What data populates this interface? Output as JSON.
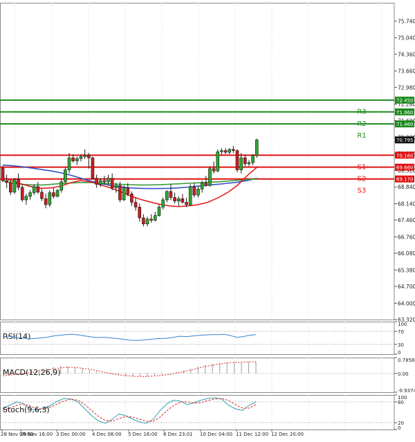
{
  "chart_data": {
    "type": "candlestick",
    "price_axis": {
      "min": 63.32,
      "max": 76.5,
      "ticks": [
        "75.740",
        "75.040",
        "74.360",
        "73.660",
        "72.980",
        "72.280",
        "71.600",
        "70.900",
        "70.220",
        "69.520",
        "68.840",
        "68.140",
        "67.460",
        "66.760",
        "66.080",
        "65.380",
        "64.700",
        "64.000",
        "63.320"
      ]
    },
    "levels": [
      {
        "name": "R3",
        "value": 72.45,
        "label": "72.450",
        "color": "#1a8a1a"
      },
      {
        "name": "R2",
        "value": 71.96,
        "label": "71.960",
        "color": "#1a8a1a"
      },
      {
        "name": "R1",
        "value": 71.46,
        "label": "71.460",
        "color": "#1a8a1a"
      },
      {
        "name": "S1",
        "value": 70.16,
        "label": "70.160",
        "color": "#e01010"
      },
      {
        "name": "S2",
        "value": 69.66,
        "label": "69.660",
        "color": "#e01010"
      },
      {
        "name": "S3",
        "value": 69.17,
        "label": "69.170",
        "color": "#e01010"
      }
    ],
    "current_price": {
      "value": 70.795,
      "label": "70.795"
    },
    "candles": [
      [
        69.62,
        69.72,
        69.05,
        69.1
      ],
      [
        69.1,
        69.35,
        68.78,
        69.02
      ],
      [
        69.02,
        69.1,
        68.5,
        68.62
      ],
      [
        68.62,
        69.2,
        68.55,
        69.15
      ],
      [
        69.15,
        69.4,
        68.7,
        68.82
      ],
      [
        68.82,
        68.95,
        68.22,
        68.3
      ],
      [
        68.3,
        68.55,
        68.1,
        68.45
      ],
      [
        68.45,
        68.7,
        68.3,
        68.6
      ],
      [
        68.6,
        68.95,
        68.5,
        68.85
      ],
      [
        68.85,
        69.05,
        68.55,
        68.62
      ],
      [
        68.62,
        68.75,
        68.25,
        68.35
      ],
      [
        68.35,
        68.55,
        67.95,
        68.1
      ],
      [
        68.1,
        68.7,
        68.0,
        68.6
      ],
      [
        68.6,
        68.8,
        68.35,
        68.45
      ],
      [
        68.45,
        68.75,
        68.4,
        68.7
      ],
      [
        68.7,
        69.15,
        68.6,
        69.05
      ],
      [
        69.05,
        69.65,
        69.0,
        69.55
      ],
      [
        69.55,
        70.25,
        69.4,
        70.05
      ],
      [
        70.05,
        70.2,
        69.85,
        69.92
      ],
      [
        69.92,
        70.1,
        69.75,
        70.02
      ],
      [
        70.02,
        70.2,
        69.9,
        70.1
      ],
      [
        70.1,
        70.4,
        70.0,
        70.15
      ],
      [
        70.15,
        70.25,
        69.6,
        70.05
      ],
      [
        70.05,
        70.1,
        69.15,
        69.2
      ],
      [
        69.2,
        69.35,
        68.8,
        68.95
      ],
      [
        68.95,
        69.2,
        68.85,
        69.1
      ],
      [
        69.1,
        69.3,
        68.95,
        69.05
      ],
      [
        69.05,
        69.35,
        68.9,
        69.2
      ],
      [
        69.2,
        69.4,
        68.7,
        68.8
      ],
      [
        68.8,
        69.0,
        68.6,
        68.9
      ],
      [
        68.9,
        69.05,
        68.2,
        68.3
      ],
      [
        68.3,
        68.9,
        68.25,
        68.8
      ],
      [
        68.8,
        69.0,
        68.45,
        68.55
      ],
      [
        68.55,
        68.65,
        68.05,
        68.2
      ],
      [
        68.2,
        68.4,
        67.85,
        68.0
      ],
      [
        68.0,
        68.15,
        67.4,
        67.55
      ],
      [
        67.55,
        67.7,
        67.2,
        67.3
      ],
      [
        67.3,
        67.6,
        67.2,
        67.5
      ],
      [
        67.5,
        67.7,
        67.35,
        67.45
      ],
      [
        67.45,
        67.8,
        67.4,
        67.65
      ],
      [
        67.65,
        68.1,
        67.6,
        68.0
      ],
      [
        68.0,
        68.4,
        67.9,
        68.3
      ],
      [
        68.3,
        68.7,
        68.2,
        68.65
      ],
      [
        68.65,
        68.95,
        68.3,
        68.4
      ],
      [
        68.4,
        68.6,
        68.15,
        68.25
      ],
      [
        68.25,
        68.45,
        68.05,
        68.35
      ],
      [
        68.35,
        68.55,
        68.15,
        68.2
      ],
      [
        68.2,
        68.4,
        68.0,
        68.1
      ],
      [
        68.1,
        68.95,
        68.05,
        68.85
      ],
      [
        68.85,
        69.0,
        68.4,
        68.5
      ],
      [
        68.5,
        68.85,
        68.4,
        68.75
      ],
      [
        68.75,
        69.1,
        68.6,
        69.0
      ],
      [
        69.0,
        69.3,
        68.85,
        68.9
      ],
      [
        68.9,
        69.7,
        68.85,
        69.6
      ],
      [
        69.6,
        69.9,
        69.4,
        69.5
      ],
      [
        69.5,
        70.4,
        69.45,
        70.3
      ],
      [
        70.3,
        70.45,
        70.15,
        70.35
      ],
      [
        70.35,
        70.45,
        70.2,
        70.28
      ],
      [
        70.28,
        70.45,
        70.2,
        70.4
      ],
      [
        70.4,
        70.55,
        70.25,
        70.35
      ],
      [
        70.35,
        70.4,
        69.45,
        69.55
      ],
      [
        69.55,
        70.25,
        69.4,
        70.05
      ],
      [
        70.05,
        70.2,
        69.7,
        69.8
      ],
      [
        69.8,
        69.95,
        69.7,
        69.85
      ],
      [
        69.85,
        70.2,
        69.75,
        70.15
      ],
      [
        70.15,
        70.85,
        70.05,
        70.795
      ]
    ],
    "ma_red": [
      69.22,
      69.08,
      68.95,
      68.84,
      68.78,
      68.8,
      68.88,
      69.02,
      69.1,
      69.05,
      68.92,
      68.8,
      68.65,
      68.48,
      68.33,
      68.22,
      68.12,
      68.05,
      68.02,
      68.05,
      68.1,
      68.2,
      68.38,
      68.6,
      68.9,
      69.3,
      69.65
    ],
    "ma_green": [
      69.1,
      69.0,
      68.95,
      68.92,
      68.92,
      68.95,
      68.98,
      69.0,
      69.02,
      69.02,
      69.0,
      68.97,
      68.95,
      68.93,
      68.92,
      68.92,
      68.93,
      68.95,
      68.97,
      68.99,
      69.01,
      69.03,
      69.05,
      69.08,
      69.11,
      69.14,
      69.17
    ],
    "ma_blue": [
      69.75,
      69.72,
      69.68,
      69.62,
      69.56,
      69.5,
      69.42,
      69.32,
      69.2,
      69.08,
      68.98,
      68.9,
      68.84,
      68.8,
      68.78,
      68.77,
      68.77,
      68.78,
      68.8,
      68.83,
      68.87,
      68.91,
      68.95,
      68.99,
      69.03,
      69.1,
      69.2
    ],
    "x_labels": [
      "28 Nov 08:00",
      "29 Nov 16:00",
      "3 Dec 00:00",
      "4 Dec 08:00",
      "5 Dec 16:00",
      "8 Dec 23:01",
      "10 Dec 04:00",
      "11 Dec 12:00",
      "12 Dec 20:00"
    ],
    "indicators": {
      "rsi": {
        "title": "RSI(14)",
        "ticks": [
          "100",
          "70",
          "30",
          "0"
        ],
        "range": [
          0,
          100
        ],
        "values": [
          54,
          55,
          52,
          50,
          47,
          48,
          50,
          52,
          56,
          58,
          60,
          61,
          59,
          56,
          53,
          51,
          52,
          50,
          48,
          46,
          43,
          42,
          43,
          45,
          47,
          48,
          49,
          52,
          55,
          54,
          56,
          58,
          59,
          60,
          60,
          61,
          57,
          52,
          54,
          58,
          60
        ]
      },
      "macd": {
        "title": "MACD(12,26,9)",
        "ticks": [
          "0.7858",
          "0.00",
          "-0.9374"
        ],
        "range": [
          -0.9374,
          0.7858
        ],
        "histogram": [
          0.01,
          0.03,
          0.06,
          0.1,
          0.14,
          0.2,
          0.26,
          0.32,
          0.38,
          0.36,
          0.32,
          0.26,
          0.18,
          0.1,
          0.02,
          -0.05,
          -0.1,
          -0.14,
          -0.16,
          -0.16,
          -0.15,
          -0.12,
          -0.08,
          -0.02,
          0.06,
          0.14,
          0.24,
          0.34,
          0.42,
          0.48,
          0.52,
          0.55,
          0.56,
          0.55,
          0.57,
          0.59
        ],
        "signal": [
          -0.12,
          -0.08,
          -0.04,
          0,
          0.04,
          0.1,
          0.16,
          0.22,
          0.28,
          0.3,
          0.29,
          0.26,
          0.21,
          0.14,
          0.06,
          -0.01,
          -0.07,
          -0.11,
          -0.14,
          -0.15,
          -0.15,
          -0.13,
          -0.1,
          -0.05,
          0.01,
          0.09,
          0.17,
          0.26,
          0.34,
          0.41,
          0.47,
          0.52,
          0.55,
          0.56,
          0.57,
          0.58
        ]
      },
      "stoch": {
        "title": "Stoch(9,6,3)",
        "ticks": [
          "100",
          "80",
          "20",
          "0"
        ],
        "range": [
          0,
          100
        ],
        "k": [
          60,
          70,
          80,
          75,
          60,
          55,
          62,
          70,
          82,
          90,
          88,
          80,
          60,
          40,
          25,
          18,
          30,
          45,
          40,
          30,
          22,
          18,
          30,
          55,
          75,
          85,
          82,
          72,
          78,
          85,
          90,
          92,
          88,
          70,
          60,
          55,
          70,
          80
        ],
        "d": [
          55,
          62,
          70,
          74,
          68,
          60,
          60,
          65,
          74,
          83,
          88,
          85,
          72,
          55,
          38,
          26,
          24,
          32,
          38,
          36,
          30,
          24,
          24,
          36,
          55,
          70,
          80,
          80,
          76,
          78,
          84,
          88,
          90,
          84,
          72,
          62,
          62,
          72
        ]
      }
    }
  }
}
